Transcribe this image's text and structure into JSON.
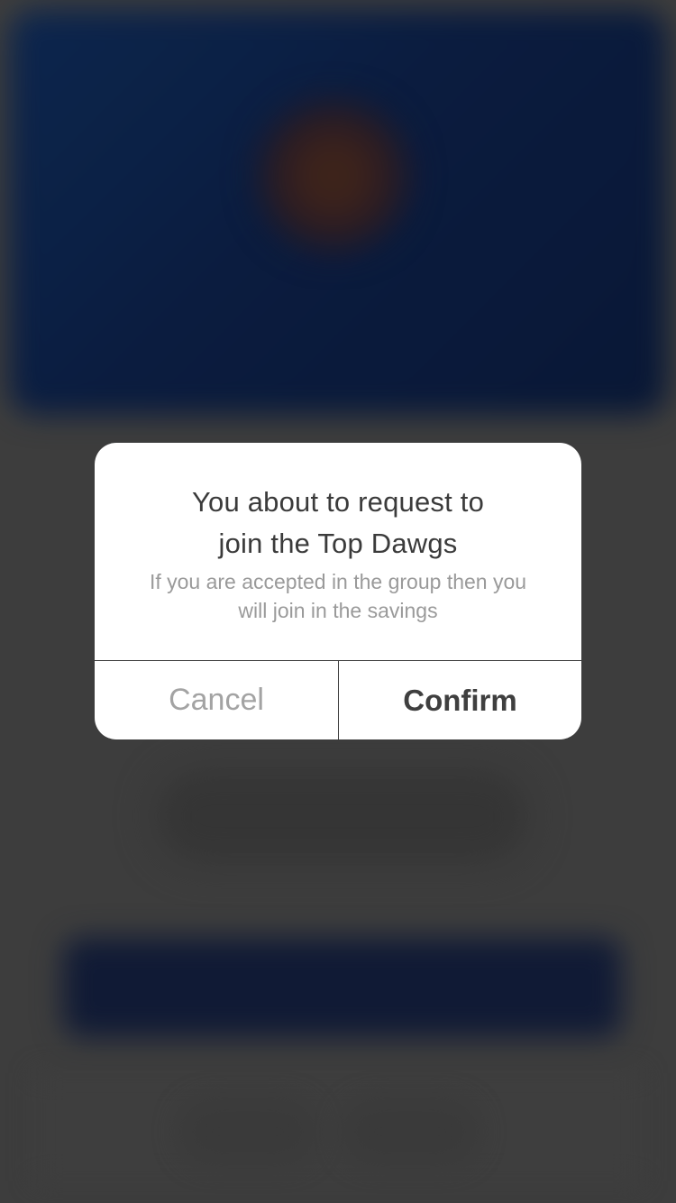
{
  "dialog": {
    "title_line1": "You about to request to",
    "title_line2": "join the Top Dawgs",
    "message_line1": "If you are accepted in the group then you",
    "message_line2": "will join in the savings",
    "cancel_label": "Cancel",
    "confirm_label": "Confirm"
  },
  "colors": {
    "overlay_background": "#434343",
    "header_blue": "#0c1f45",
    "dialog_background": "#ffffff",
    "title_text": "#3b3b3b",
    "message_text": "#9a9a9a",
    "cancel_text": "#a3a3a3",
    "confirm_text": "#3f3f3f"
  }
}
